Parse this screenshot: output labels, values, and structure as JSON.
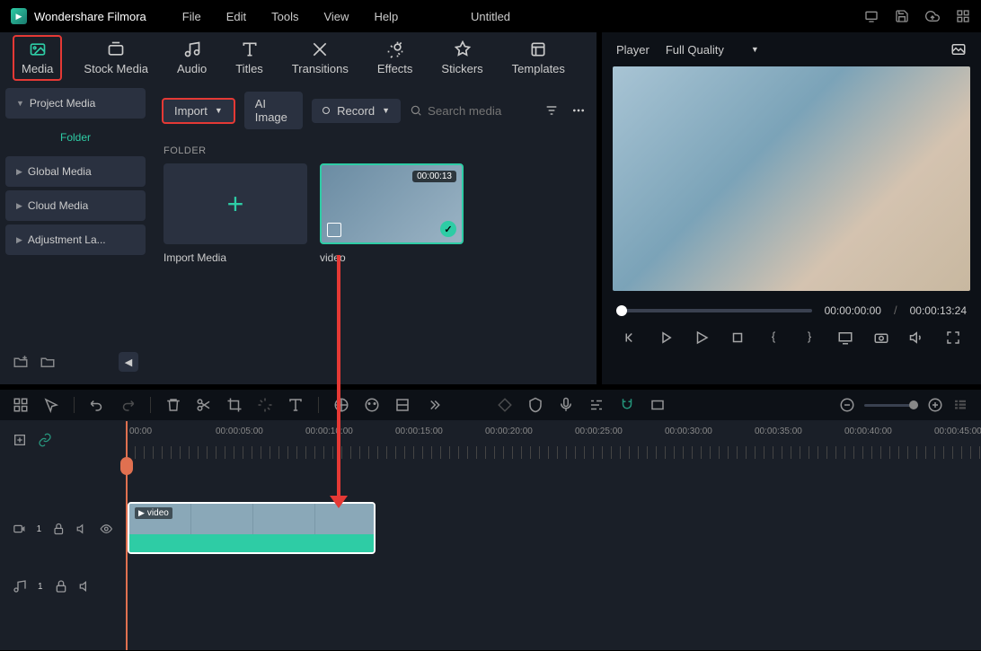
{
  "app": {
    "title": "Wondershare Filmora",
    "project": "Untitled"
  },
  "menu": [
    "File",
    "Edit",
    "Tools",
    "View",
    "Help"
  ],
  "tabs": [
    {
      "label": "Media"
    },
    {
      "label": "Stock Media"
    },
    {
      "label": "Audio"
    },
    {
      "label": "Titles"
    },
    {
      "label": "Transitions"
    },
    {
      "label": "Effects"
    },
    {
      "label": "Stickers"
    },
    {
      "label": "Templates"
    }
  ],
  "sidebar": {
    "project": "Project Media",
    "folder": "Folder",
    "items": [
      "Global Media",
      "Cloud Media",
      "Adjustment La..."
    ]
  },
  "toolbar": {
    "import": "Import",
    "ai": "AI Image",
    "record": "Record",
    "search_placeholder": "Search media"
  },
  "browser": {
    "section": "FOLDER",
    "import_tile": "Import Media",
    "video_tile": "video",
    "video_duration": "00:00:13"
  },
  "preview": {
    "label": "Player",
    "quality": "Full Quality",
    "current": "00:00:00:00",
    "total": "00:00:13:24"
  },
  "timeline": {
    "marks": [
      "00:00",
      "00:00:05:00",
      "00:00:10:00",
      "00:00:15:00",
      "00:00:20:00",
      "00:00:25:00",
      "00:00:30:00",
      "00:00:35:00",
      "00:00:40:00",
      "00:00:45:00"
    ],
    "clip_label": "video",
    "video_track": "1",
    "audio_track": "1"
  }
}
